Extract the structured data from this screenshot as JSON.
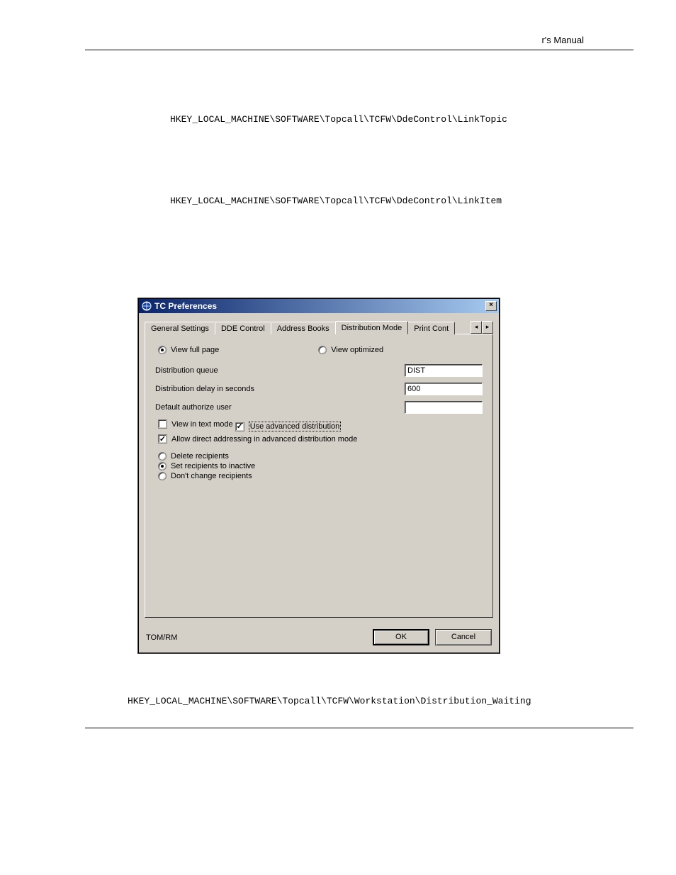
{
  "header": {
    "right_text": "r's Manual"
  },
  "registry_paths": {
    "link_topic": "HKEY_LOCAL_MACHINE\\SOFTWARE\\Topcall\\TCFW\\DdeControl\\LinkTopic",
    "link_item": "HKEY_LOCAL_MACHINE\\SOFTWARE\\Topcall\\TCFW\\DdeControl\\LinkItem",
    "dist_waiting": "HKEY_LOCAL_MACHINE\\SOFTWARE\\Topcall\\TCFW\\Workstation\\Distribution_Waiting"
  },
  "dialog": {
    "title": "TC Preferences",
    "close_glyph": "×",
    "tabs": {
      "general": "General Settings",
      "dde": "DDE Control",
      "address": "Address Books",
      "dist": "Distribution Mode",
      "print": "Print Cont",
      "scroll_left": "◂",
      "scroll_right": "▸"
    },
    "view_mode": {
      "full": "View full page",
      "optimized": "View optimized",
      "selected": "full"
    },
    "fields": {
      "dist_queue_label": "Distribution queue",
      "dist_queue_value": "DIST",
      "delay_label": "Distribution delay in seconds",
      "delay_value": "600",
      "auth_user_label": "Default authorize user",
      "auth_user_value": ""
    },
    "checks": {
      "text_mode": {
        "label": "View in text mode",
        "checked": false
      },
      "adv_dist": {
        "label": "Use advanced distribution",
        "checked": true
      },
      "allow_direct": {
        "label": "Allow direct addressing in advanced distribution mode",
        "checked": true
      }
    },
    "recipients": {
      "delete": "Delete recipients",
      "inactive": "Set recipients to inactive",
      "nochange": "Don't change recipients",
      "selected": "inactive"
    },
    "footer": {
      "status": "TOM/RM",
      "ok": "OK",
      "cancel": "Cancel"
    }
  }
}
